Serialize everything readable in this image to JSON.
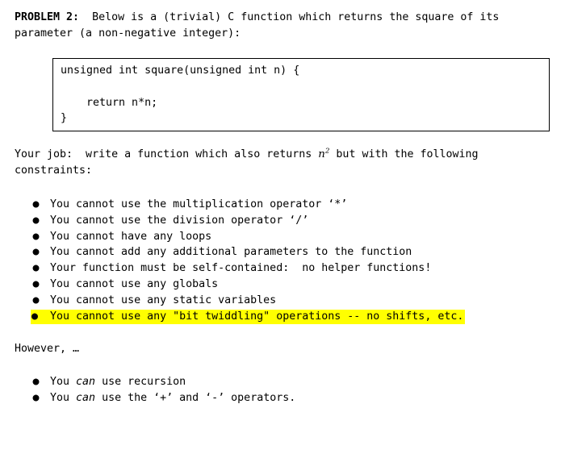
{
  "document": {
    "problem_label": "PROBLEM 2:",
    "intro_text_1": "  Below is a (trivial) C function which returns the square of its parameter (a non-negative integer):",
    "code_block": {
      "line1": "unsigned int square(unsigned int n) {",
      "line2": "",
      "line3": "    return n*n;",
      "line4": "}"
    },
    "job_prefix": "Your job:  write a function which also returns ",
    "job_math_base": "n",
    "job_math_exponent": "2",
    "job_suffix": " but with the following constraints:",
    "constraints": [
      {
        "text": "You cannot use the multiplication operator ‘*’",
        "highlighted": false
      },
      {
        "text": "You cannot use the division operator ‘/’",
        "highlighted": false
      },
      {
        "text": "You cannot have any loops",
        "highlighted": false
      },
      {
        "text": "You cannot add any additional parameters to the function",
        "highlighted": false
      },
      {
        "text": "Your function must be self-contained:  no helper functions!",
        "highlighted": false
      },
      {
        "text": "You cannot use any globals",
        "highlighted": false
      },
      {
        "text": "You cannot use any static variables",
        "highlighted": false
      },
      {
        "text": "You cannot use any \"bit twiddling\" operations -- no shifts, etc.",
        "highlighted": true
      }
    ],
    "however_text": "However, …",
    "allowances": [
      {
        "prefix": "You ",
        "emphasis": "can",
        "suffix": " use recursion"
      },
      {
        "prefix": "You ",
        "emphasis": "can",
        "suffix": " use the ‘+’ and ‘-’ operators."
      }
    ],
    "bullet_glyph": "●",
    "colors": {
      "highlight": "#ffff00",
      "text": "#000000",
      "background": "#ffffff",
      "border": "#000000"
    }
  }
}
